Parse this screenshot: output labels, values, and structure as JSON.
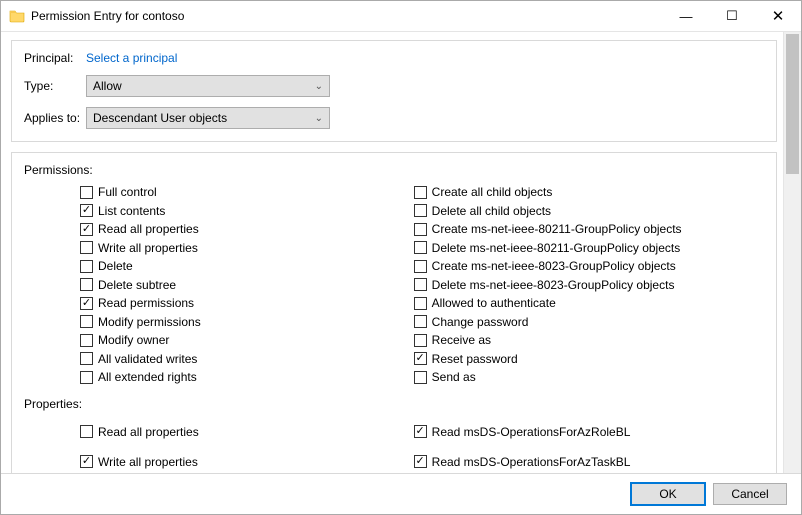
{
  "window": {
    "title": "Permission Entry for contoso"
  },
  "header": {
    "principal_label": "Principal:",
    "principal_link": "Select a principal",
    "type_label": "Type:",
    "type_value": "Allow",
    "applies_label": "Applies to:",
    "applies_value": "Descendant User objects"
  },
  "permissions": {
    "section_label": "Permissions:",
    "left": [
      {
        "label": "Full control",
        "checked": false
      },
      {
        "label": "List contents",
        "checked": true
      },
      {
        "label": "Read all properties",
        "checked": true
      },
      {
        "label": "Write all properties",
        "checked": false
      },
      {
        "label": "Delete",
        "checked": false
      },
      {
        "label": "Delete subtree",
        "checked": false
      },
      {
        "label": "Read permissions",
        "checked": true
      },
      {
        "label": "Modify permissions",
        "checked": false
      },
      {
        "label": "Modify owner",
        "checked": false
      },
      {
        "label": "All validated writes",
        "checked": false
      },
      {
        "label": "All extended rights",
        "checked": false
      }
    ],
    "right": [
      {
        "label": "Create all child objects",
        "checked": false
      },
      {
        "label": "Delete all child objects",
        "checked": false
      },
      {
        "label": "Create ms-net-ieee-80211-GroupPolicy objects",
        "checked": false
      },
      {
        "label": "Delete ms-net-ieee-80211-GroupPolicy objects",
        "checked": false
      },
      {
        "label": "Create ms-net-ieee-8023-GroupPolicy objects",
        "checked": false
      },
      {
        "label": "Delete ms-net-ieee-8023-GroupPolicy objects",
        "checked": false
      },
      {
        "label": "Allowed to authenticate",
        "checked": false
      },
      {
        "label": "Change password",
        "checked": false
      },
      {
        "label": "Receive as",
        "checked": false
      },
      {
        "label": "Reset password",
        "checked": true
      },
      {
        "label": "Send as",
        "checked": false
      }
    ]
  },
  "properties": {
    "section_label": "Properties:",
    "left": [
      {
        "label": "Read all properties",
        "checked": false
      },
      {
        "label": "Write all properties",
        "checked": true
      }
    ],
    "right": [
      {
        "label": "Read msDS-OperationsForAzRoleBL",
        "checked": true
      },
      {
        "label": "Read msDS-OperationsForAzTaskBL",
        "checked": true
      }
    ]
  },
  "footer": {
    "ok": "OK",
    "cancel": "Cancel"
  },
  "glyphs": {
    "check": "✓",
    "chev": "⌄",
    "min": "—",
    "max": "☐",
    "close": "✕"
  }
}
